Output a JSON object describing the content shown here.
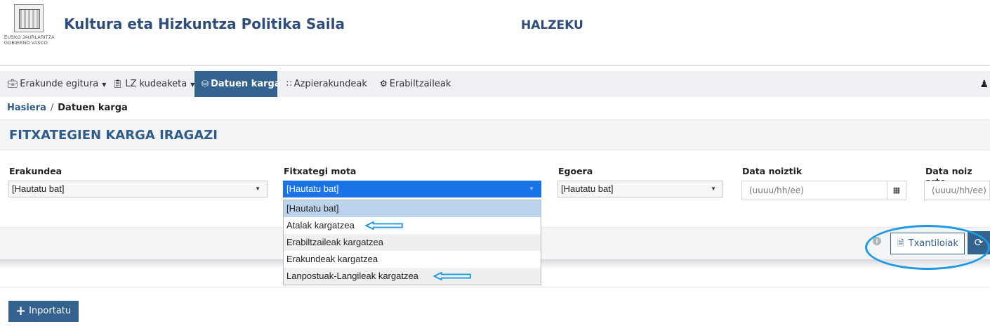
{
  "header": {
    "logo_line1": "EUSKO JAURLARITZA",
    "logo_line2": "GOBIERNO VASCO",
    "department": "Kultura eta Hizkuntza Politika Saila",
    "app_name": "HALZEKU"
  },
  "nav": {
    "items": [
      {
        "label": "Erakunde egitura",
        "icon": "briefcase-icon",
        "dropdown": true
      },
      {
        "label": "LZ kudeaketa",
        "icon": "clipboard-icon",
        "dropdown": true
      },
      {
        "label": "Datuen karga",
        "icon": "database-icon",
        "active": true
      },
      {
        "label": "Azpierakundeak",
        "icon": "grid-icon"
      },
      {
        "label": "Erabiltzaileak",
        "icon": "users-cog-icon"
      }
    ],
    "user_icon": "user-icon"
  },
  "breadcrumb": {
    "home": "Hasiera",
    "separator": "/",
    "current": "Datuen karga"
  },
  "panel": {
    "title": "FITXATEGIEN KARGA IRAGAZI"
  },
  "filters": {
    "erakundea": {
      "label": "Erakundea",
      "value": "[Hautatu bat]"
    },
    "fitxategi_mota": {
      "label": "Fitxategi mota",
      "value": "[Hautatu bat]"
    },
    "egoera": {
      "label": "Egoera",
      "value": "[Hautatu bat]"
    },
    "data_noiztik": {
      "label": "Data noiztik",
      "placeholder": "(uuuu/hh/ee)"
    },
    "data_noiz_arte": {
      "label": "Data noiz arte",
      "placeholder": "(uuuu/hh/ee)"
    }
  },
  "dropdown": {
    "options": [
      "[Hautatu bat]",
      "Atalak kargatzea",
      "Erabiltzaileak kargatzea",
      "Erakundeak kargatzea",
      "Lanpostuak-Langileak kargatzea"
    ],
    "selected_index": 0,
    "highlighted_options": [
      "Atalak kargatzea",
      "Lanpostuak-Langileak kargatzea"
    ]
  },
  "actions": {
    "templates_label": "Txantiloiak",
    "import_label": "Inportatu"
  },
  "colors": {
    "brand": "#34628f",
    "title": "#2f5c8a",
    "open_select": "#1a73e8",
    "selected_option": "#bcd3ed",
    "annotation": "#1d9ae0"
  }
}
